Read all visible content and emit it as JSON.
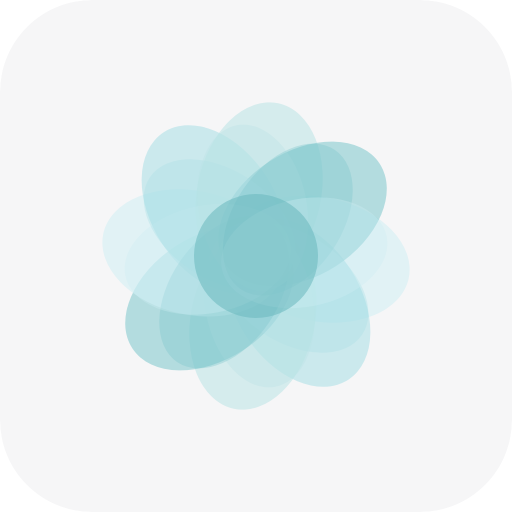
{
  "icon": {
    "name": "breathe-flower-icon",
    "colors": {
      "background": "#f6f6f7",
      "petal_pale": "#cfeef4",
      "petal_mid": "#a8dfe6",
      "petal_deep": "#7cc6cc",
      "petal_edge": "#b9e3e6",
      "center_core": "#69b8bd"
    },
    "petal_count": 8
  }
}
